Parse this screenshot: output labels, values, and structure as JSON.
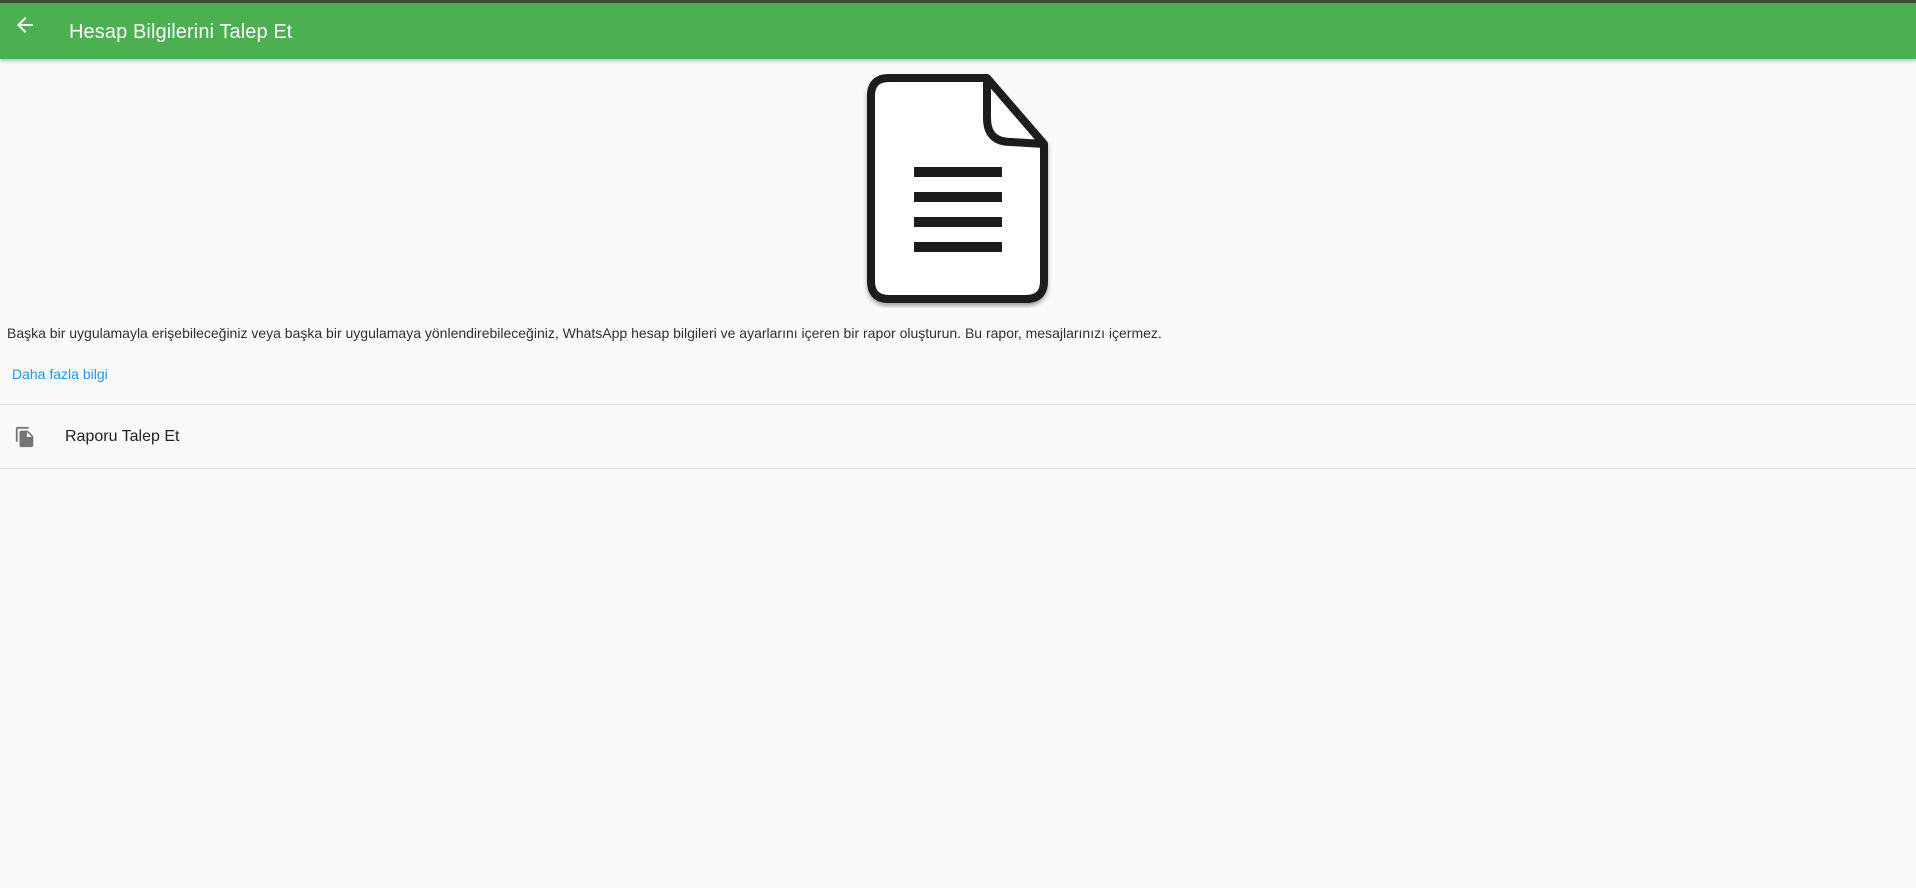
{
  "header": {
    "title": "Hesap Bilgilerini Talep Et",
    "back_icon": "arrow-back-icon",
    "background_color": "#4caf50"
  },
  "illustration": {
    "icon": "document-icon"
  },
  "main": {
    "description": "Başka bir uygulamayla erişebileceğiniz veya başka bir uygulamaya yönlendirebileceğiniz, WhatsApp hesap bilgileri ve ayarlarını içeren bir rapor oluşturun. Bu rapor, mesajlarınızı içermez.",
    "learn_more_label": "Daha fazla bilgi",
    "link_color": "#2196f3"
  },
  "actions": {
    "request_report": {
      "label": "Raporu Talep Et",
      "icon": "file-copy-icon"
    }
  }
}
